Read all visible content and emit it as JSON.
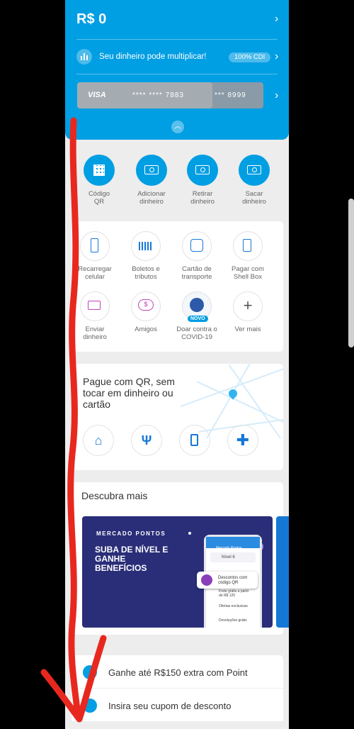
{
  "hero": {
    "balance": "R$ 0",
    "multiplier_text": "Seu dinheiro pode multiplicar!",
    "cdi_badge": "100% CDI",
    "card_brand": "VISA",
    "card_mask": "**** **** 7883",
    "card2_mask": "*** 8999"
  },
  "quick_actions": [
    {
      "line1": "Código",
      "line2": "QR",
      "icon": "qr-code-icon"
    },
    {
      "line1": "Adicionar",
      "line2": "dinheiro",
      "icon": "add-money-icon"
    },
    {
      "line1": "Retirar",
      "line2": "dinheiro",
      "icon": "withdraw-money-icon"
    },
    {
      "line1": "Sacar",
      "line2": "dinheiro",
      "icon": "cash-out-icon"
    }
  ],
  "services": [
    {
      "line1": "Recarregar",
      "line2": "celular",
      "icon": "phone-recharge-icon"
    },
    {
      "line1": "Boletos e",
      "line2": "tributos",
      "icon": "barcode-icon"
    },
    {
      "line1": "Cartão de",
      "line2": "transporte",
      "icon": "bus-icon"
    },
    {
      "line1": "Pagar com",
      "line2": "Shell Box",
      "icon": "fuel-pump-icon"
    },
    {
      "line1": "Enviar",
      "line2": "dinheiro",
      "icon": "send-money-icon"
    },
    {
      "line1": "Amigos",
      "line2": "",
      "icon": "friends-chat-icon"
    },
    {
      "line1": "Doar contra o",
      "line2": "COVID-19",
      "icon": "donate-icon",
      "badge": "NOVO"
    },
    {
      "line1": "Ver mais",
      "line2": "",
      "icon": "plus-icon"
    }
  ],
  "qr_pay": {
    "title_l1": "Pague com QR, sem",
    "title_l2": "tocar em dinheiro ou",
    "title_l3": "cartão",
    "categories": [
      "basket-icon",
      "restaurant-icon",
      "fuel-pump-icon",
      "pharmacy-cross-icon"
    ]
  },
  "discover": {
    "title": "Descubra mais",
    "promo_kicker": "MERCADO PONTOS",
    "promo_l1": "SUBA DE NÍVEL E",
    "promo_l2": "GANHE",
    "promo_l3": "BENEFÍCIOS",
    "mock_header": "Mercado Pontos",
    "mock_level": "Nível 6",
    "mock_bubble": "Descontos com código QR",
    "mock_row1": "Frete grátis a partir de R$ 120",
    "mock_row2": "Ofertas exclusivas",
    "mock_row3": "Devoluções grátis"
  },
  "bottom": {
    "point_text": "Ganhe até R$150 extra com Point",
    "coupon_text": "Insira seu cupom de desconto"
  },
  "colors": {
    "brand_blue": "#009ee3",
    "annotation_red": "#e8281e",
    "promo_navy": "#2a2e78"
  }
}
